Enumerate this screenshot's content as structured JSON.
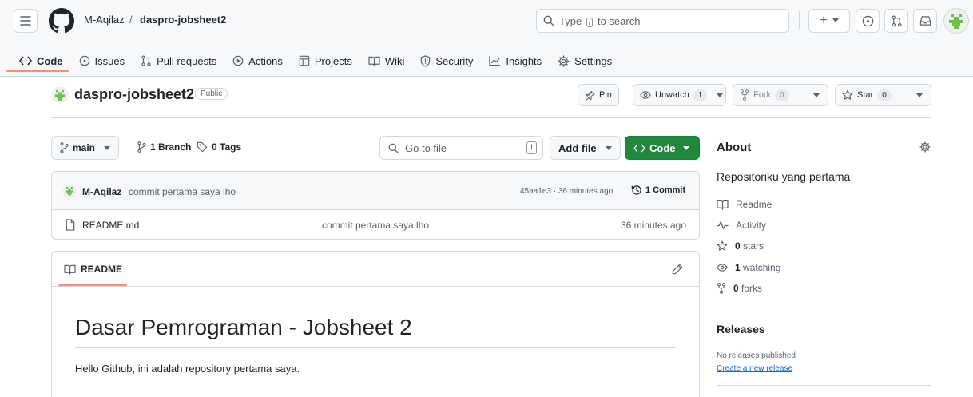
{
  "header": {
    "owner": "M-Aqilaz",
    "separator": "/",
    "repo": "daspro-jobsheet2",
    "search_prefix": "Type",
    "search_key": "/",
    "search_suffix": "to search",
    "plus_label": "+"
  },
  "tabs": [
    {
      "label": "Code",
      "icon": "code-icon"
    },
    {
      "label": "Issues",
      "icon": "issue-icon"
    },
    {
      "label": "Pull requests",
      "icon": "pull-request-icon"
    },
    {
      "label": "Actions",
      "icon": "play-icon"
    },
    {
      "label": "Projects",
      "icon": "table-icon"
    },
    {
      "label": "Wiki",
      "icon": "book-icon"
    },
    {
      "label": "Security",
      "icon": "shield-icon"
    },
    {
      "label": "Insights",
      "icon": "graph-icon"
    },
    {
      "label": "Settings",
      "icon": "gear-icon"
    }
  ],
  "repo": {
    "name": "daspro-jobsheet2",
    "visibility": "Public",
    "pin_label": "Pin",
    "watch_label": "Unwatch",
    "watch_count": "1",
    "fork_label": "Fork",
    "fork_count": "0",
    "star_label": "Star",
    "star_count": "0"
  },
  "toolbar": {
    "branch": "main",
    "branch_count": "1 Branch",
    "tag_count": "0 Tags",
    "goto_placeholder": "Go to file",
    "goto_key": "t",
    "add_file_label": "Add file",
    "code_label": "Code"
  },
  "commit": {
    "author": "M-Aqilaz",
    "message": "commit pertama saya lho",
    "meta": "45aa1e3 · 36 minutes ago",
    "count": "1 Commit"
  },
  "files": [
    {
      "name": "README.md",
      "message": "commit pertama saya lho",
      "time": "36 minutes ago"
    }
  ],
  "readme": {
    "tab_label": "README",
    "heading": "Dasar Pemrograman - Jobsheet 2",
    "body": "Hello Github, ini adalah repository pertama saya."
  },
  "about": {
    "title": "About",
    "description": "Repositoriku yang pertama",
    "readme": "Readme",
    "activity": "Activity",
    "stars_num": "0",
    "stars_word": "stars",
    "watching_num": "1",
    "watching_word": "watching",
    "forks_num": "0",
    "forks_word": "forks"
  },
  "releases": {
    "title": "Releases",
    "none": "No releases published",
    "create_link": "Create a new release"
  },
  "colors": {
    "accent_green": "#1f883d",
    "tab_underline": "#fd8c73",
    "link_blue": "#0969da"
  }
}
